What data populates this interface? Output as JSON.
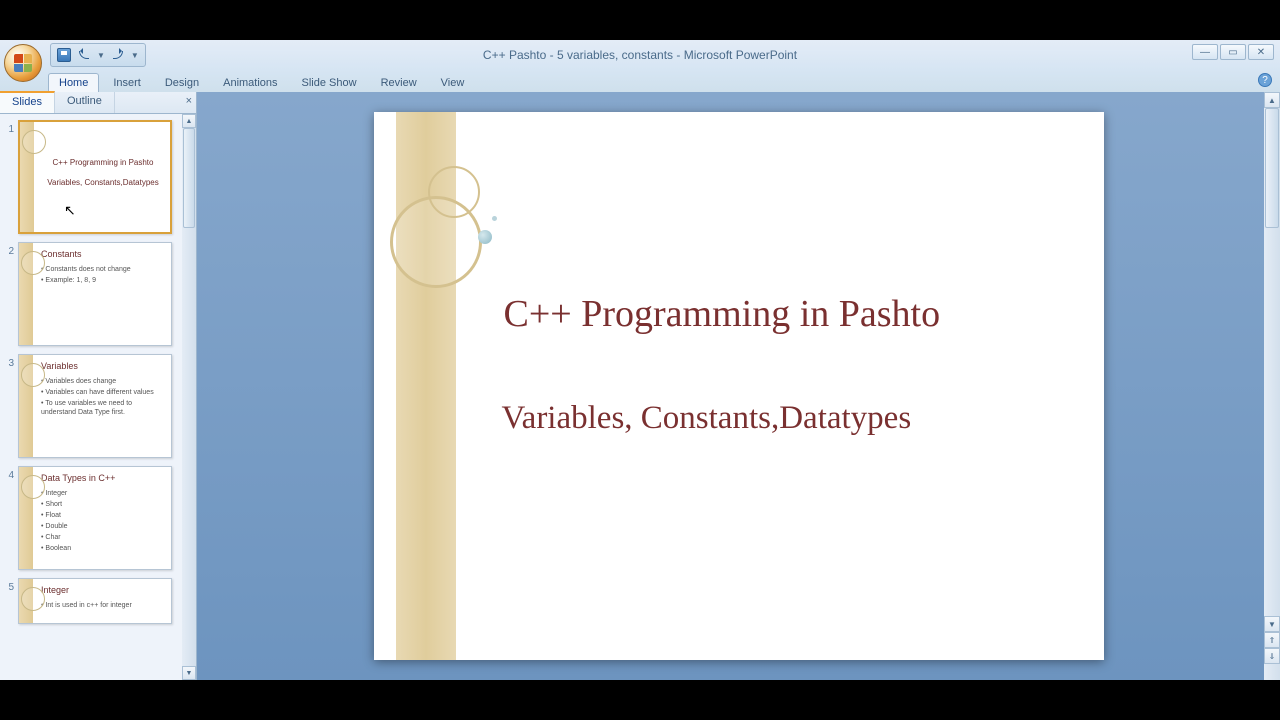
{
  "window": {
    "title": "C++ Pashto - 5 variables, constants - Microsoft PowerPoint"
  },
  "ribbon": {
    "tabs": [
      "Home",
      "Insert",
      "Design",
      "Animations",
      "Slide Show",
      "Review",
      "View"
    ],
    "active": "Home"
  },
  "panel": {
    "tabs": [
      "Slides",
      "Outline"
    ],
    "active": "Slides",
    "close": "×"
  },
  "thumbnails": [
    {
      "num": "1",
      "selected": true,
      "title": "C++ Programming in Pashto",
      "sub": "Variables, Constants,Datatypes",
      "lines": []
    },
    {
      "num": "2",
      "selected": false,
      "title": "Constants",
      "sub": "",
      "lines": [
        "• Constants does not change",
        "• Example: 1, 8, 9"
      ]
    },
    {
      "num": "3",
      "selected": false,
      "title": "Variables",
      "sub": "",
      "lines": [
        "• Variables does change",
        "• Variables can have different values",
        "• To use variables we need to understand Data Type first."
      ]
    },
    {
      "num": "4",
      "selected": false,
      "title": "Data Types in C++",
      "sub": "",
      "lines": [
        "• Integer",
        "• Short",
        "• Float",
        "• Double",
        "• Char",
        "• Boolean"
      ]
    },
    {
      "num": "5",
      "selected": false,
      "title": "Integer",
      "sub": "",
      "lines": [
        "• Int is used in c++ for integer"
      ]
    }
  ],
  "slide": {
    "title": "C++ Programming in Pashto",
    "subtitle": "Variables, Constants,Datatypes"
  }
}
